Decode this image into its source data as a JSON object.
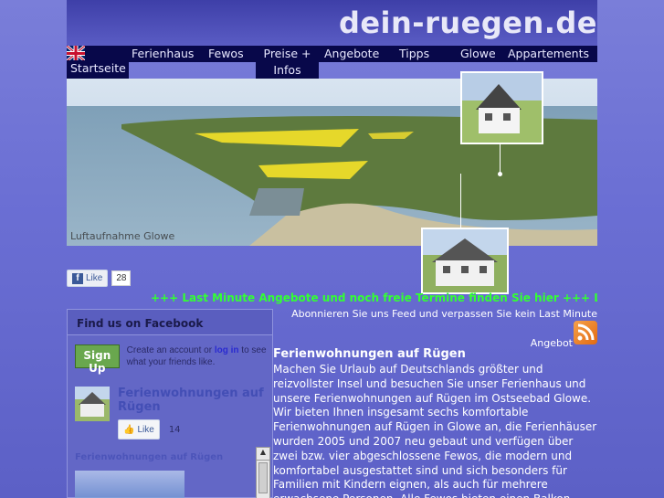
{
  "site": {
    "title": "dein-ruegen.de"
  },
  "nav": {
    "items": [
      {
        "label": "Startseite"
      },
      {
        "label": "Ferienhaus"
      },
      {
        "label": "Fewos"
      },
      {
        "label": "Preise + Infos"
      },
      {
        "label": "Angebote"
      },
      {
        "label": "Tipps"
      },
      {
        "label": "Glowe"
      },
      {
        "label": "Appartements"
      }
    ],
    "language_icon": "uk-flag-icon"
  },
  "hero": {
    "caption": "Luftaufnahme Glowe"
  },
  "like_widget": {
    "label": "Like",
    "count": "28"
  },
  "ticker": {
    "text": "+++ Last Minute Angebote und noch freie Termine finden Sie hier +++ L"
  },
  "feed": {
    "text": "Abonnieren Sie uns Feed und verpassen Sie kein Last Minute",
    "link": "Angebot",
    "icon": "rss-icon"
  },
  "facebook_box": {
    "heading": "Find us on Facebook",
    "signup_label": "Sign Up",
    "signup_text_pre": "Create an account or ",
    "signup_link": "log in",
    "signup_text_post": " to see what your friends like.",
    "page_name": "Ferienwohnungen auf Rügen",
    "like_label": "Like",
    "like_count": "14",
    "sub_label": "Ferienwohnungen auf Rügen"
  },
  "content": {
    "title": "Ferienwohnungen auf Rügen",
    "body": "Machen Sie Urlaub auf Deutschlands größter und reizvollster Insel und besuchen Sie unser Ferienhaus und unsere Ferienwohnungen auf Rügen im Ostseebad Glowe. Wir bieten Ihnen insgesamt sechs komfortable Ferienwohnungen auf Rügen in Glowe an, die Ferienhäuser wurden 2005 und 2007 neu gebaut und verfügen über zwei bzw. vier abgeschlossene Fewos, die modern und komfortabel ausgestattet sind und sich besonders für Familien mit Kindern eignen, als auch für mehrere erwachsene Personen.   Alle Fewos bieten einen Balkon, Terrasse oder einen Garten mit"
  },
  "colors": {
    "ticker": "#33ff33",
    "nav_bg": "#08084a",
    "background": "#6b6fd4"
  }
}
